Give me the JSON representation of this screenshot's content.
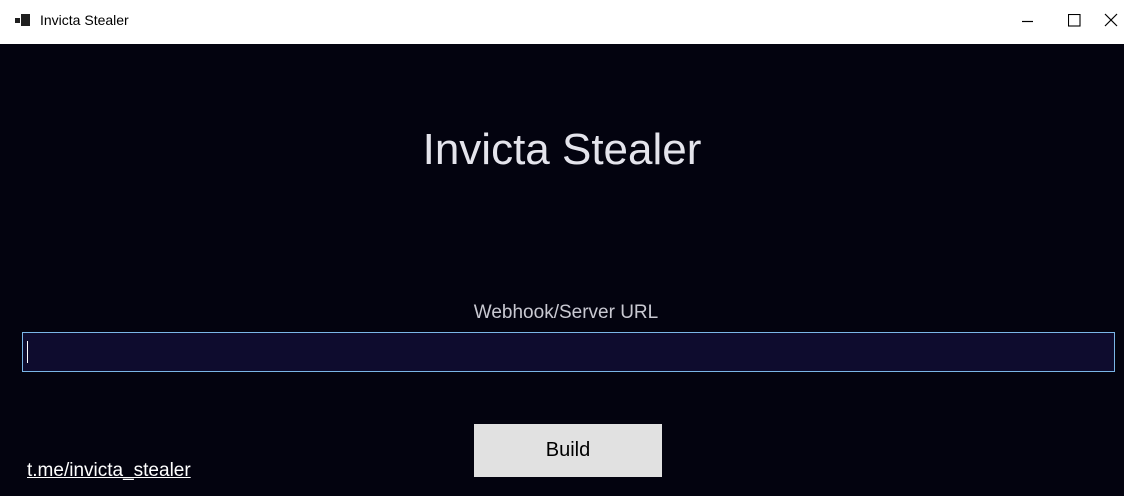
{
  "window": {
    "title": "Invicta Stealer",
    "icon": "app-window-icon",
    "controls": {
      "minimize_icon": "minimize-icon",
      "maximize_icon": "maximize-icon",
      "close_icon": "close-icon"
    }
  },
  "main": {
    "heading": "Invicta Stealer",
    "url_field": {
      "label": "Webhook/Server URL",
      "value": "",
      "placeholder": ""
    },
    "build_button_label": "Build",
    "footer_link": "t.me/invicta_stealer"
  },
  "colors": {
    "background": "#03030f",
    "input_background": "#0e0c2e",
    "input_border": "#7ab6e6",
    "button_background": "#e1e1e1",
    "heading_text": "#e4e4ec"
  }
}
